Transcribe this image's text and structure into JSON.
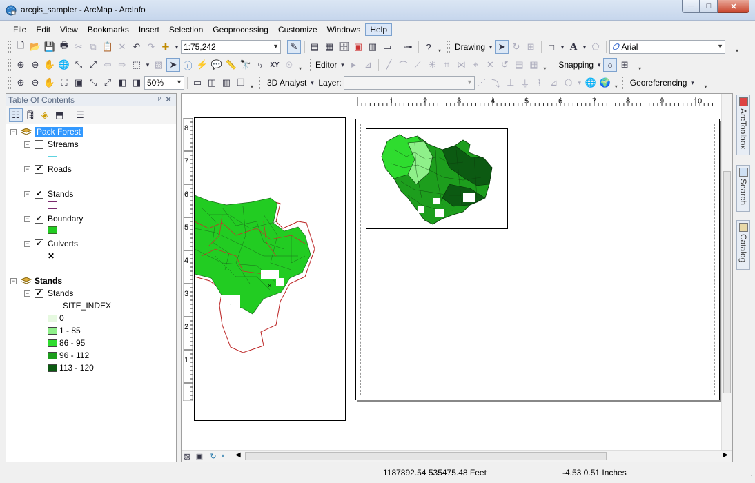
{
  "window": {
    "title": "arcgis_sampler - ArcMap - ArcInfo",
    "minimize": "─",
    "maximize": "□",
    "close": "✕"
  },
  "menu": [
    "File",
    "Edit",
    "View",
    "Bookmarks",
    "Insert",
    "Selection",
    "Geoprocessing",
    "Customize",
    "Windows",
    "Help"
  ],
  "menu_active": "Help",
  "toolbar": {
    "scale": "1:75,242",
    "drawing_label": "Drawing",
    "font": "Arial",
    "font_icon": "A",
    "editor_label": "Editor",
    "snapping_label": "Snapping",
    "zoom": "50%",
    "analyst_label": "3D Analyst",
    "layer_label": "Layer:",
    "layer_value": "",
    "georef_label": "Georeferencing"
  },
  "toc": {
    "title": "Table Of Contents",
    "pin": "ᵖ",
    "close": "✕",
    "frame1": {
      "name": "Pack Forest",
      "layers": [
        {
          "name": "Streams",
          "checked": false,
          "symbol": "line",
          "symbol_color": "#5fd3e0"
        },
        {
          "name": "Roads",
          "checked": true,
          "symbol": "line",
          "symbol_color": "#c0392b"
        },
        {
          "name": "Stands",
          "checked": true,
          "symbol": "poly",
          "symbol_color": "#ffffff",
          "outline": "#7a2a6e"
        },
        {
          "name": "Boundary",
          "checked": true,
          "symbol": "poly",
          "symbol_color": "#22cc22",
          "outline": "#3b6b2b"
        },
        {
          "name": "Culverts",
          "checked": true,
          "symbol": "x",
          "symbol_text": "✕"
        }
      ]
    },
    "frame2": {
      "name": "Stands",
      "layer": "Stands",
      "field": "SITE_INDEX",
      "classes": [
        {
          "label": "0",
          "color": "#e6f9e0"
        },
        {
          "label": "1 - 85",
          "color": "#8ff08a"
        },
        {
          "label": "86 - 95",
          "color": "#2fdc2f"
        },
        {
          "label": "96 - 112",
          "color": "#1d9e1d"
        },
        {
          "label": "113 - 120",
          "color": "#0c5a12"
        }
      ]
    }
  },
  "rulers": {
    "horizontal": [
      "1",
      "2",
      "3",
      "4",
      "5",
      "6",
      "7",
      "8",
      "9",
      "10"
    ],
    "vertical": [
      "8",
      "7",
      "6",
      "5",
      "4",
      "3",
      "2",
      "1"
    ]
  },
  "dock": [
    "ArcToolbox",
    "Search",
    "Catalog"
  ],
  "status": {
    "coords": "1187892.54  535475.48 Feet",
    "page": "-4.53  0.51 Inches"
  }
}
